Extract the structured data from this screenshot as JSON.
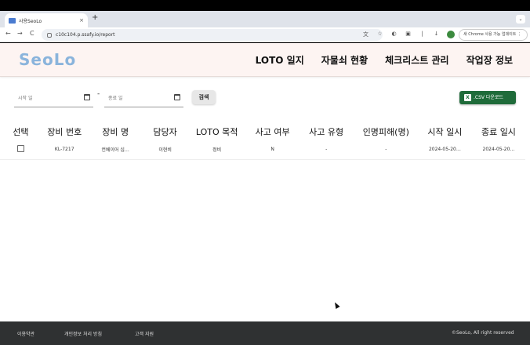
{
  "browser": {
    "tab_title": "사용SeoLo",
    "tab_close": "×",
    "new_tab": "+",
    "tab_menu": "⌄",
    "back": "←",
    "forward": "→",
    "reload": "C",
    "url": "c10c104.p.ssafy.io/report",
    "update_label": "새 Chrome 사용 가능 업데이트 ⋮"
  },
  "header": {
    "logo": "SeoLo",
    "menu": [
      "LOTO 일지",
      "자물쇠 현황",
      "체크리스트 관리",
      "작업장 정보"
    ]
  },
  "filters": {
    "start_placeholder": "시작 일",
    "end_placeholder": "종료 일",
    "dash": "-",
    "search_label": "검색",
    "csv_label": ".CSV 다운로드",
    "csv_icon": "X"
  },
  "table": {
    "columns": [
      "선택",
      "장비 번호",
      "장비 명",
      "담당자",
      "LOTO 목적",
      "사고 여부",
      "사고 유형",
      "인명피해(명)",
      "시작 일시",
      "종료 일시"
    ],
    "rows": [
      [
        "",
        "KL-7217",
        "컨베이어 심…",
        "이현비",
        "정비",
        "N",
        "-",
        "-",
        "2024-05-20…",
        "2024-05-20…"
      ]
    ]
  },
  "footer": {
    "links": [
      "이용약관",
      "개인정보 처리 방침",
      "고객 지원"
    ],
    "copyright": "©SeoLo, All right reserved"
  }
}
